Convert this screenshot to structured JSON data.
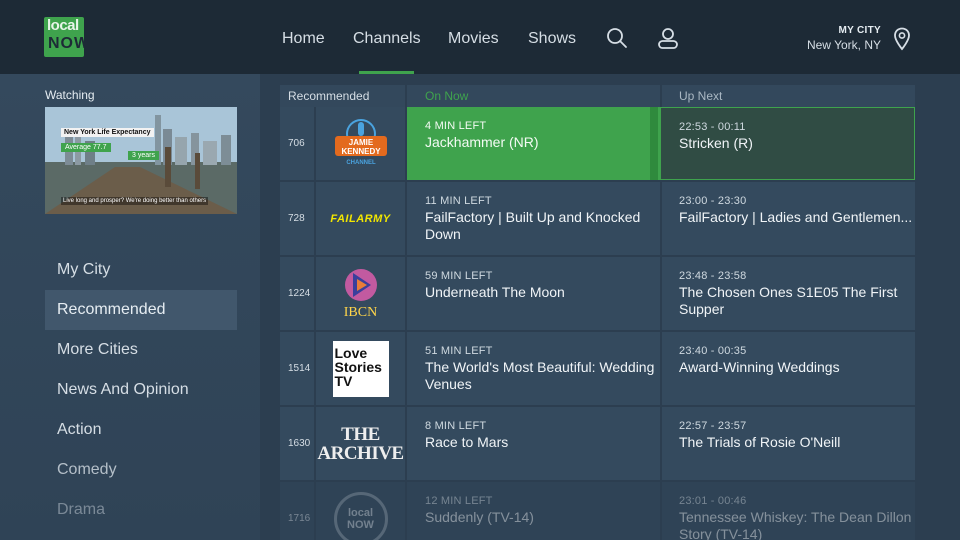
{
  "app": {
    "logo_line1": "local",
    "logo_line2": "NOW"
  },
  "nav": {
    "items": [
      "Home",
      "Channels",
      "Movies",
      "Shows"
    ],
    "active": "Channels"
  },
  "location": {
    "label": "MY CITY",
    "city": "New York, NY"
  },
  "icons": {
    "search": "search-icon",
    "profile": "user-icon",
    "location": "location-pin-icon"
  },
  "watching": {
    "label": "Watching",
    "preview_title": "New York Life Expectancy",
    "preview_avg": "Average 77.7",
    "preview_years": "3 years",
    "preview_caption": "Live long and prosper? We're doing better than others"
  },
  "categories": [
    "My City",
    "Recommended",
    "More Cities",
    "News And Opinion",
    "Action",
    "Comedy",
    "Drama"
  ],
  "selected_category": "Recommended",
  "guide": {
    "headers": {
      "channel": "Recommended",
      "on_now": "On Now",
      "up_next": "Up Next"
    },
    "rows": [
      {
        "number": "706",
        "logo": "jamie-kennedy-channel",
        "logo_text": [
          "JAMIE",
          "KENNEDY",
          "CHANNEL"
        ],
        "now_time": "4 MIN LEFT",
        "now_title": "Jackhammer (NR)",
        "next_time": "22:53 - 00:11",
        "next_title": "Stricken (R)"
      },
      {
        "number": "728",
        "logo": "failarmy",
        "logo_text": [
          "FAILARMY"
        ],
        "now_time": "11 MIN LEFT",
        "now_title": "FailFactory | Built Up and Knocked Down",
        "next_time": "23:00 - 23:30",
        "next_title": "FailFactory | Ladies and Gentlemen..."
      },
      {
        "number": "1224",
        "logo": "ibcn",
        "logo_text": [
          "IBCN"
        ],
        "now_time": "59 MIN LEFT",
        "now_title": "Underneath The Moon",
        "next_time": "23:48 - 23:58",
        "next_title": "The Chosen Ones S1E05 The First Supper"
      },
      {
        "number": "1514",
        "logo": "love-stories-tv",
        "logo_text": [
          "Love",
          "Stories",
          "TV"
        ],
        "now_time": "51 MIN LEFT",
        "now_title": "The World's Most Beautiful: Wedding Venues",
        "next_time": "23:40 - 00:35",
        "next_title": "Award-Winning Weddings"
      },
      {
        "number": "1630",
        "logo": "the-archive",
        "logo_text": [
          "THE",
          "ARCHIVE"
        ],
        "now_time": "8 MIN LEFT",
        "now_title": " Race to Mars",
        "next_time": "22:57 - 23:57",
        "next_title": " The Trials of Rosie O'Neill"
      },
      {
        "number": "1716",
        "logo": "local-now",
        "logo_text": [
          "local",
          "NOW"
        ],
        "now_time": "12 MIN LEFT",
        "now_title": "Suddenly (TV-14)",
        "next_time": "23:01 - 00:46",
        "next_title": "Tennessee Whiskey: The Dean Dillon Story (TV-14)"
      }
    ]
  },
  "colors": {
    "accent": "#3fa34d",
    "header_bg": "#1d2a36",
    "panel_bg": "#2c3e50",
    "cell_bg": "#344a5e"
  }
}
